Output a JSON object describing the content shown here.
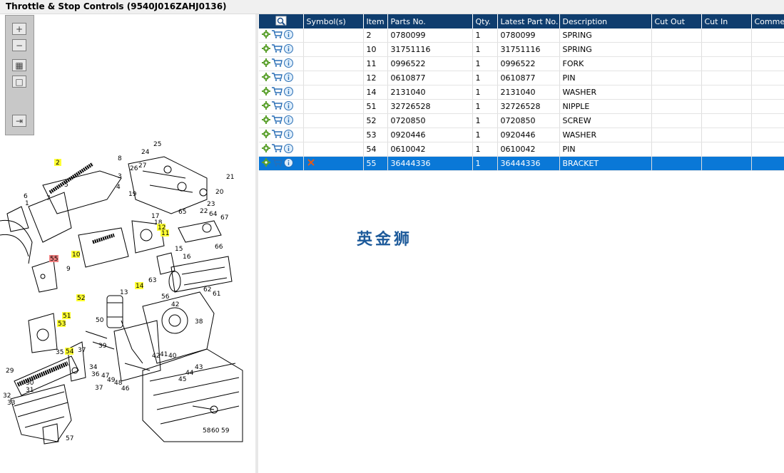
{
  "window": {
    "title": "Throttle & Stop Controls (9540J016ZAHJ0136)"
  },
  "toolbar": {
    "buttons": [
      {
        "name": "zoom-in-button",
        "glyph": "+"
      },
      {
        "name": "zoom-out-button",
        "glyph": "−"
      },
      {
        "name": "fit-page-button",
        "glyph": "▦"
      },
      {
        "name": "actual-size-button",
        "glyph": "□"
      },
      {
        "name": "toggle-panel-button",
        "glyph": "⇥"
      }
    ]
  },
  "grid": {
    "columns": [
      "",
      "Symbol(s)",
      "Item",
      "Parts No.",
      "Qty.",
      "Latest Part No.",
      "Description",
      "Cut Out",
      "Cut In",
      "Comment"
    ],
    "rows": [
      {
        "item": "2",
        "part": "0780099",
        "qty": "1",
        "latest": "0780099",
        "desc": "SPRING"
      },
      {
        "item": "10",
        "part": "31751116",
        "qty": "1",
        "latest": "31751116",
        "desc": "SPRING"
      },
      {
        "item": "11",
        "part": "0996522",
        "qty": "1",
        "latest": "0996522",
        "desc": "FORK"
      },
      {
        "item": "12",
        "part": "0610877",
        "qty": "1",
        "latest": "0610877",
        "desc": "PIN"
      },
      {
        "item": "14",
        "part": "2131040",
        "qty": "1",
        "latest": "2131040",
        "desc": "WASHER"
      },
      {
        "item": "51",
        "part": "32726528",
        "qty": "1",
        "latest": "32726528",
        "desc": "NIPPLE"
      },
      {
        "item": "52",
        "part": "0720850",
        "qty": "1",
        "latest": "0720850",
        "desc": "SCREW"
      },
      {
        "item": "53",
        "part": "0920446",
        "qty": "1",
        "latest": "0920446",
        "desc": "WASHER"
      },
      {
        "item": "54",
        "part": "0610042",
        "qty": "1",
        "latest": "0610042",
        "desc": "PIN"
      },
      {
        "item": "55",
        "part": "36444336",
        "qty": "1",
        "latest": "36444336",
        "desc": "BRACKET",
        "selected": true
      }
    ]
  },
  "watermark": "英金狮",
  "diagram": {
    "labels": [
      {
        "t": "2",
        "hl": "yellow"
      },
      {
        "t": "8"
      },
      {
        "t": "3"
      },
      {
        "t": "4"
      },
      {
        "t": "5"
      },
      {
        "t": "6"
      },
      {
        "t": "7"
      },
      {
        "t": "1"
      },
      {
        "t": "25"
      },
      {
        "t": "24"
      },
      {
        "t": "27"
      },
      {
        "t": "26"
      },
      {
        "t": "19"
      },
      {
        "t": "21"
      },
      {
        "t": "20"
      },
      {
        "t": "23"
      },
      {
        "t": "65"
      },
      {
        "t": "22"
      },
      {
        "t": "64"
      },
      {
        "t": "67"
      },
      {
        "t": "66"
      },
      {
        "t": "17"
      },
      {
        "t": "18"
      },
      {
        "t": "12",
        "hl": "yellow"
      },
      {
        "t": "11",
        "hl": "yellow"
      },
      {
        "t": "10",
        "hl": "yellow"
      },
      {
        "t": "15"
      },
      {
        "t": "16"
      },
      {
        "t": "55",
        "hl": "red"
      },
      {
        "t": "9"
      },
      {
        "t": "63"
      },
      {
        "t": "14",
        "hl": "yellow"
      },
      {
        "t": "13"
      },
      {
        "t": "62"
      },
      {
        "t": "61"
      },
      {
        "t": "52",
        "hl": "yellow"
      },
      {
        "t": "56"
      },
      {
        "t": "42"
      },
      {
        "t": "51",
        "hl": "yellow"
      },
      {
        "t": "50"
      },
      {
        "t": "53",
        "hl": "yellow"
      },
      {
        "t": "38"
      },
      {
        "t": "39"
      },
      {
        "t": "35"
      },
      {
        "t": "54",
        "hl": "yellow"
      },
      {
        "t": "37"
      },
      {
        "t": "41"
      },
      {
        "t": "42"
      },
      {
        "t": "40"
      },
      {
        "t": "43"
      },
      {
        "t": "29"
      },
      {
        "t": "34"
      },
      {
        "t": "36"
      },
      {
        "t": "47"
      },
      {
        "t": "49"
      },
      {
        "t": "48"
      },
      {
        "t": "46"
      },
      {
        "t": "44"
      },
      {
        "t": "45"
      },
      {
        "t": "30"
      },
      {
        "t": "31"
      },
      {
        "t": "32"
      },
      {
        "t": "37"
      },
      {
        "t": "33"
      },
      {
        "t": "57"
      },
      {
        "t": "58"
      },
      {
        "t": "60"
      },
      {
        "t": "59"
      }
    ]
  }
}
